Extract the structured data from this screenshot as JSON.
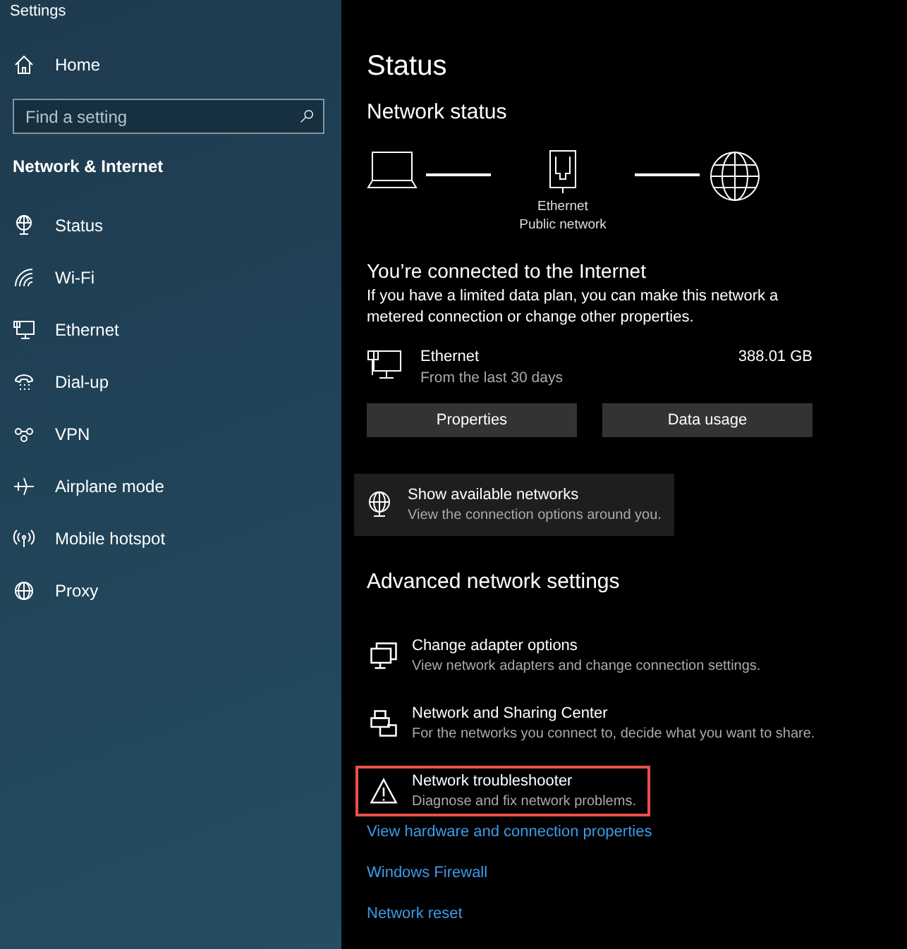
{
  "window": {
    "title": "Settings"
  },
  "sidebar": {
    "home": {
      "label": "Home"
    },
    "search": {
      "placeholder": "Find a setting"
    },
    "section": "Network & Internet",
    "items": [
      {
        "label": "Status",
        "kind": "status"
      },
      {
        "label": "Wi-Fi",
        "kind": "wifi"
      },
      {
        "label": "Ethernet",
        "kind": "ethernet"
      },
      {
        "label": "Dial-up",
        "kind": "dialup"
      },
      {
        "label": "VPN",
        "kind": "vpn"
      },
      {
        "label": "Airplane mode",
        "kind": "airplane"
      },
      {
        "label": "Mobile hotspot",
        "kind": "hotspot"
      },
      {
        "label": "Proxy",
        "kind": "proxy"
      }
    ]
  },
  "main": {
    "title": "Status",
    "subtitle": "Network status",
    "diagram": {
      "adapter": "Ethernet",
      "network": "Public network"
    },
    "connection": {
      "heading": "You’re connected to the Internet",
      "description": "If you have a limited data plan, you can make this network a metered connection or change other properties."
    },
    "usage": {
      "name": "Ethernet",
      "period": "From the last 30 days",
      "amount": "388.01 GB"
    },
    "buttons": [
      "Properties",
      "Data usage"
    ],
    "available": {
      "title": "Show available networks",
      "description": "View the connection options around you."
    },
    "advanced_heading": "Advanced network settings",
    "advanced": [
      {
        "kind": "adapter",
        "title": "Change adapter options",
        "description": "View network adapters and change connection settings.",
        "highlighted": false
      },
      {
        "kind": "sharing",
        "title": "Network and Sharing Center",
        "description": "For the networks you connect to, decide what you want to share.",
        "highlighted": false
      },
      {
        "kind": "warning",
        "title": "Network troubleshooter",
        "description": "Diagnose and fix network problems.",
        "highlighted": true
      }
    ],
    "links": [
      "View hardware and connection properties",
      "Windows Firewall",
      "Network reset"
    ]
  }
}
